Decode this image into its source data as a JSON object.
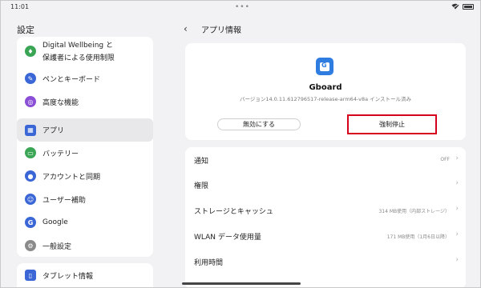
{
  "status_bar": {
    "time": "11:01",
    "dots": "•••"
  },
  "sidebar": {
    "title": "設定",
    "items": [
      {
        "label_line1": "Digital Wellbeing と",
        "label_line2": "保護者による使用制限",
        "icon": "wellbeing-icon",
        "color": "#3aa655"
      },
      {
        "label": "ペンとキーボード",
        "icon": "pen-icon",
        "color": "#3a66d6"
      },
      {
        "label": "高度な機能",
        "icon": "advanced-icon",
        "color": "#8a4fd6"
      },
      {
        "label": "アプリ",
        "icon": "apps-icon",
        "color": "#3a66d6",
        "selected": true
      },
      {
        "label": "バッテリー",
        "icon": "battery-icon",
        "color": "#3aa655"
      },
      {
        "label": "アカウントと同期",
        "icon": "account-icon",
        "color": "#3a66d6"
      },
      {
        "label": "ユーザー補助",
        "icon": "accessibility-icon",
        "color": "#3a66d6"
      },
      {
        "label": "Google",
        "icon": "google-icon",
        "color": "#3a66d6"
      },
      {
        "label": "一般設定",
        "icon": "gear-icon",
        "color": "#8a8a8a"
      },
      {
        "label": "タブレット情報",
        "icon": "tablet-icon",
        "color": "#3a66d6"
      }
    ]
  },
  "main": {
    "title": "アプリ情報",
    "app": {
      "name": "Gboard",
      "version": "バージョン14.0.11.612796517-release-arm64-v8a インストール済み",
      "disable_label": "無効にする",
      "force_stop_label": "強制停止",
      "accent": "#d6001c"
    },
    "rows": [
      {
        "label": "通知",
        "value": "OFF"
      },
      {
        "label": "権限",
        "value": ""
      },
      {
        "label": "ストレージとキャッシュ",
        "value": "314 MB使用（内部ストレージ）"
      },
      {
        "label": "WLAN データ使用量",
        "value": "171 MB使用（1月6日以降）"
      },
      {
        "label": "利用時間",
        "value": ""
      }
    ]
  }
}
